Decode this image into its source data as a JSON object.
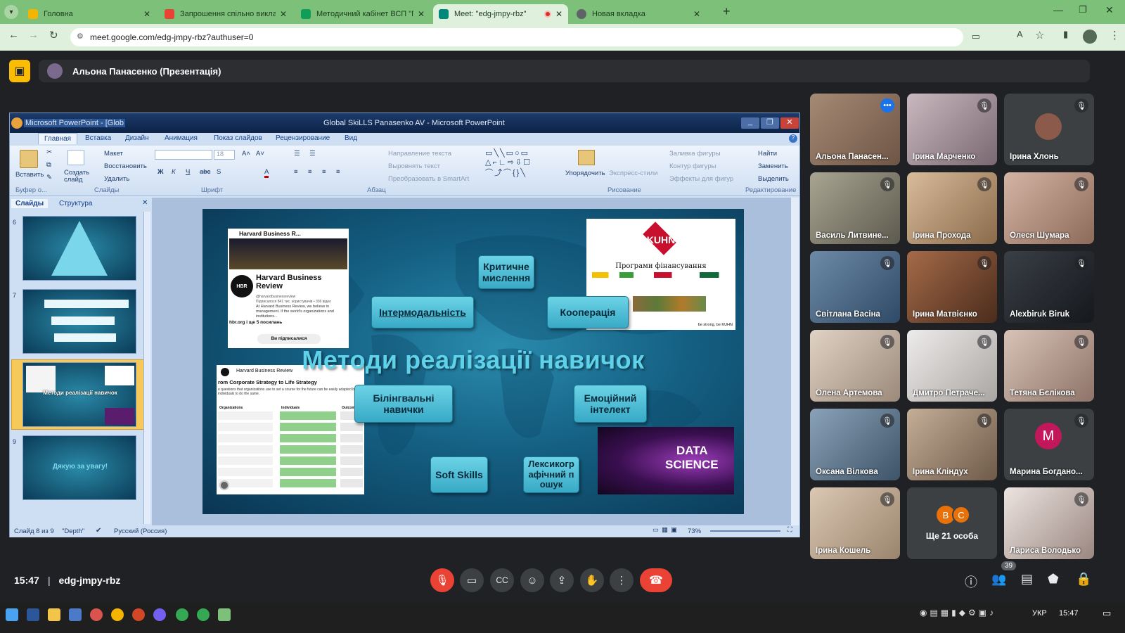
{
  "browser": {
    "tabs": [
      {
        "label": "Головна",
        "color": "#f4b400"
      },
      {
        "label": "Запрошення спільно викладати",
        "color": "#ea4335"
      },
      {
        "label": "Методичний кабінет ВСП \"ГА",
        "color": "#0f9d58"
      },
      {
        "label": "Meet: \"edg-jmpy-rbz\"",
        "color": "#00897b"
      },
      {
        "label": "Новая вкладка",
        "color": "#5f6368"
      }
    ],
    "url": "meet.google.com/edg-jmpy-rbz?authuser=0"
  },
  "meet": {
    "presenter_banner": "Альона Панасенко (Презентація)",
    "time": "15:47",
    "meeting_code": "edg-jmpy-rbz",
    "people_count": "39"
  },
  "ppt": {
    "title_left": "Microsoft PowerPoint - [Glob",
    "title_center": "Global SkiLLS Panasenko AV - Microsoft PowerPoint",
    "ribbon_tabs": [
      "Главная",
      "Вставка",
      "Дизайн",
      "Анимация",
      "Показ слайдов",
      "Рецензирование",
      "Вид"
    ],
    "groups": [
      "Буфер о...",
      "Слайды",
      "Шрифт",
      "Абзац",
      "Рисование",
      "Редактирование"
    ],
    "cmd": {
      "paste": "Вставить",
      "create_slide": "Создать слайд",
      "layout": "Макет",
      "restore": "Восстановить",
      "delete": "Удалить",
      "font_size": "18",
      "text_dir": "Направление текста",
      "align_text": "Выровнять текст",
      "smartart": "Преобразовать в SmartArt",
      "arrange": "Упорядочить",
      "quick_styles": "Экспресс-стили",
      "fill": "Заливка фигуры",
      "outline": "Контур фигуры",
      "effects": "Эффекты для фигур",
      "find": "Найти",
      "replace": "Заменить",
      "select": "Выделить"
    },
    "pane_tabs": [
      "Слайды",
      "Структура"
    ],
    "thumb_numbers": [
      "6",
      "7",
      "8",
      "9"
    ],
    "thumb_texts": [
      "Методи реалізації навичок",
      "Дякую за увагу!"
    ],
    "status": {
      "slide": "Слайд 8 из 9",
      "theme": "\"Depth\"",
      "lang": "Русский (Россия)",
      "zoom": "73%"
    }
  },
  "slide": {
    "title": "Методи реалізації навичок",
    "boxes": [
      "Критичне мислення",
      "Інтермодальність",
      "Кооперація",
      "Білінгвальні навички",
      "Емоційний інтелект",
      "Soft Skills",
      "Лексикографічний пошук"
    ],
    "hbr": {
      "name_short": "Harvard Business R...",
      "name": "Harvard Business Review",
      "handle": "@harvardbusinessreview",
      "subs": "Підписалося 841 тис. користувачів • 336 відео",
      "desc": "At Harvard Business Review, we believe in management. If the world's organizations and institutions...",
      "link": "hbr.org і ще 5 посилань",
      "subscribed": "Ви підписалися",
      "post_title": "Harvard Business Review",
      "post_heading": "rom Corporate Strategy to Life Strategy",
      "post_text": "e questions that organizations use to set a course for the future can be easily adapted by individuals to do the same.",
      "col1": "Organizations",
      "col2": "Individuals",
      "col3": "Outcome"
    },
    "kuhn": {
      "brand": "KUHN",
      "subtitle": "Програми фінансування",
      "slogan": "be strong, be KUHN"
    },
    "ds": {
      "line1": "DATA",
      "line2": "SCIENCE"
    }
  },
  "participants": [
    {
      "name": "Альона Панасен...",
      "bg": "#8a6a55",
      "speaking": true
    },
    {
      "name": "Ірина Марченко",
      "bg": "#b9a7ad"
    },
    {
      "name": "Ірина Хлонь",
      "bg": "#3c4043",
      "avatar": true
    },
    {
      "name": "Василь Литвине...",
      "bg": "#8d8a7a"
    },
    {
      "name": "Ірина Прохода",
      "bg": "#b89b7e"
    },
    {
      "name": "Олеся Шумара",
      "bg": "#b79b8b"
    },
    {
      "name": "Світлана Васіна",
      "bg": "#4f6e8c"
    },
    {
      "name": "Ірина Матвієнко",
      "bg": "#7a4e38"
    },
    {
      "name": "Alexbiruk Biruk",
      "bg": "#2a2e33"
    },
    {
      "name": "Олена Артемова",
      "bg": "#c9b8a8"
    },
    {
      "name": "Дмитро Петраче...",
      "bg": "#d7d5d3"
    },
    {
      "name": "Тетяна Бєлікова",
      "bg": "#c0a89b"
    },
    {
      "name": "Оксана Вілкова",
      "bg": "#6b86a0"
    },
    {
      "name": "Ірина Кліндух",
      "bg": "#a99684"
    },
    {
      "name": "Марина Богдано...",
      "bg": "#3c4043",
      "letter": "M"
    },
    {
      "name": "Ірина Кошель",
      "bg": "#c8b49f"
    },
    {
      "name": "Ще 21 особа",
      "bg": "#3c4043",
      "more": true
    },
    {
      "name": "Лариса Володько",
      "bg": "#cfc3bd"
    }
  ],
  "more_avatars": [
    "B",
    "C"
  ],
  "taskbar": {
    "lang": "УКР",
    "time": "15:47"
  }
}
